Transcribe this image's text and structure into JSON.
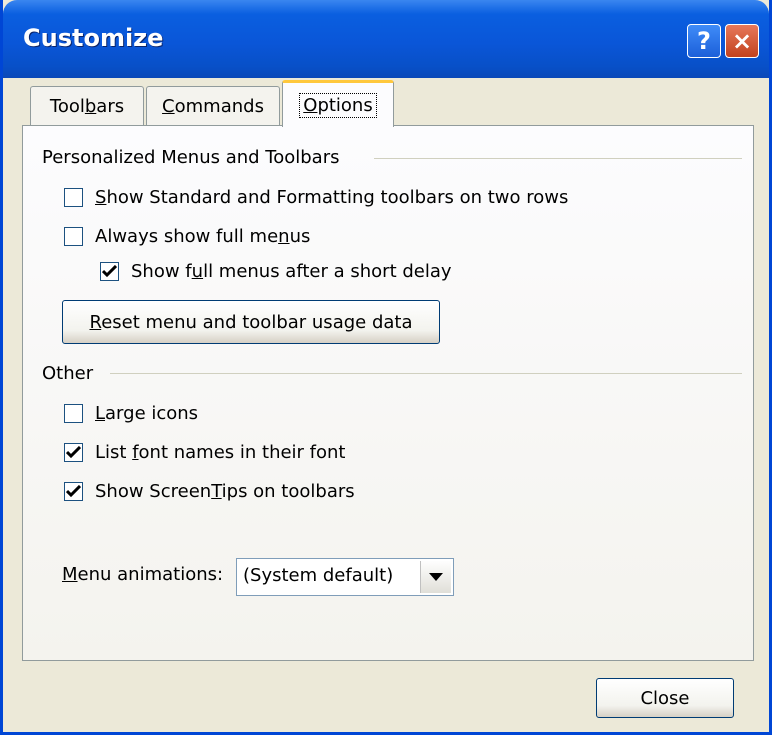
{
  "window": {
    "title": "Customize",
    "help_glyph": "?",
    "close_glyph": "×"
  },
  "tabs": [
    {
      "pre": "Tool",
      "acc": "b",
      "post": "ars",
      "selected": false
    },
    {
      "pre": "",
      "acc": "C",
      "post": "ommands",
      "selected": false
    },
    {
      "pre": "",
      "acc": "O",
      "post": "ptions",
      "selected": true
    }
  ],
  "personalized": {
    "title": "Personalized Menus and Toolbars",
    "two_rows": {
      "pre": "",
      "acc": "S",
      "post": "how Standard and Formatting toolbars on two rows",
      "checked": false
    },
    "full_menus": {
      "pre": "Always show full me",
      "acc": "n",
      "post": "us",
      "checked": false
    },
    "full_delay": {
      "pre": "Show f",
      "acc": "u",
      "post": "ll menus after a short delay",
      "checked": true
    },
    "reset": {
      "pre": "",
      "acc": "R",
      "post": "eset menu and toolbar usage data"
    }
  },
  "other": {
    "title": "Other",
    "large_icons": {
      "pre": "",
      "acc": "L",
      "post": "arge icons",
      "checked": false
    },
    "font_names": {
      "pre": "List ",
      "acc": "f",
      "post": "ont names in their font",
      "checked": true
    },
    "screentips": {
      "pre": "Show Screen",
      "acc": "T",
      "post": "ips on toolbars",
      "checked": true
    },
    "menu_anim": {
      "pre": "",
      "acc": "M",
      "post": "enu animations:",
      "value": "(System default)"
    }
  },
  "footer": {
    "close_label": "Close"
  },
  "colors": {
    "titlebar": "#0a56d8",
    "face": "#ece9d8",
    "tab_highlight": "#ffc83c",
    "check": "#21a121"
  }
}
